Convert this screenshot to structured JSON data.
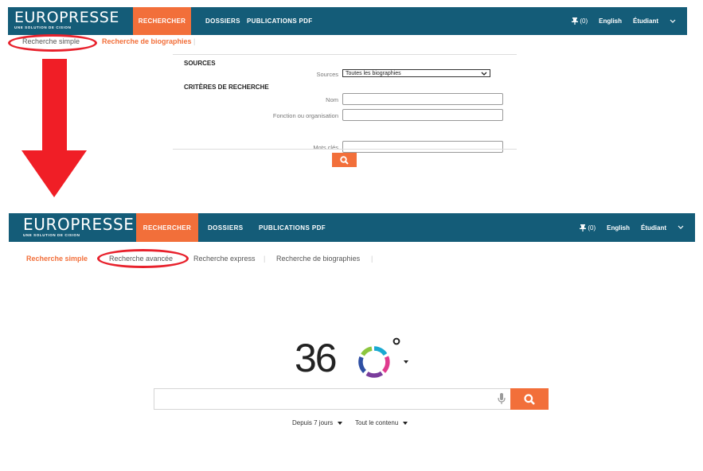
{
  "top": {
    "brand": "EUROPRESSE",
    "tagline": "UNE SOLUTION DE CISION",
    "menu": [
      "RECHERCHER",
      "DOSSIERS",
      "PUBLICATIONS PDF"
    ],
    "pin_count": "(0)",
    "language": "English",
    "user": "Étudiant",
    "subnav": {
      "simple": "Recherche simple",
      "bio": "Recherche de biographies",
      "sep": "|"
    },
    "form": {
      "sources_heading": "SOURCES",
      "sources_label": "Sources",
      "sources_value": "Toutes les biographies",
      "criteria_heading": "CRITÈRES DE RECHERCHE",
      "nom_label": "Nom",
      "fonction_label": "Fonction ou organisation",
      "mots_label": "Mots clés"
    }
  },
  "bottom": {
    "brand": "EUROPRESSE",
    "tagline": "UNE SOLUTION DE CISION",
    "menu": [
      "RECHERCHER",
      "DOSSIERS",
      "PUBLICATIONS PDF"
    ],
    "pin_count": "(0)",
    "language": "English",
    "user": "Étudiant",
    "subnav": {
      "simple": "Recherche simple",
      "avancee": "Recherche avancée",
      "express": "Recherche express",
      "bio": "Recherche de biographies",
      "sep": "|"
    },
    "logo_text": "36",
    "filters": {
      "period": "Depuis 7 jours",
      "content": "Tout le contenu"
    }
  },
  "colors": {
    "navbar": "#145c78",
    "accent": "#f26f3a",
    "annotation": "#e8212c"
  }
}
